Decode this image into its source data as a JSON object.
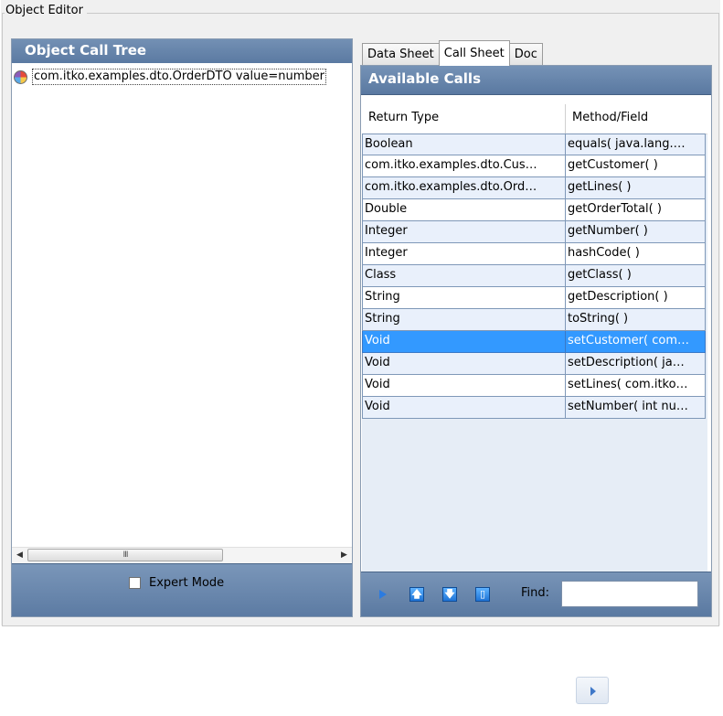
{
  "group": {
    "title": "Object Editor"
  },
  "left": {
    "header": "Object Call Tree",
    "tree_item": "com.itko.examples.dto.OrderDTO value=number",
    "scroll_grip": "III",
    "expert_mode_label": "Expert Mode",
    "expert_mode_checked": false
  },
  "tabs": [
    {
      "label": "Data Sheet",
      "active": false
    },
    {
      "label": "Call Sheet",
      "active": true
    },
    {
      "label": "Doc",
      "active": false
    }
  ],
  "calls": {
    "header": "Available Calls",
    "columns": [
      "Return Type",
      "Method/Field"
    ],
    "rows": [
      {
        "return_type": "Boolean",
        "method": "equals( java.lang.…"
      },
      {
        "return_type": "com.itko.examples.dto.Cus…",
        "method": "getCustomer( )"
      },
      {
        "return_type": "com.itko.examples.dto.Ord…",
        "method": "getLines( )"
      },
      {
        "return_type": "Double",
        "method": "getOrderTotal( )"
      },
      {
        "return_type": "Integer",
        "method": "getNumber( )"
      },
      {
        "return_type": "Integer",
        "method": "hashCode( )"
      },
      {
        "return_type": "Class",
        "method": "getClass( )"
      },
      {
        "return_type": "String",
        "method": "getDescription( )"
      },
      {
        "return_type": "String",
        "method": "toString( )"
      },
      {
        "return_type": "Void",
        "method": "setCustomer( com…",
        "selected": true
      },
      {
        "return_type": "Void",
        "method": "setDescription( ja…"
      },
      {
        "return_type": "Void",
        "method": "setLines( com.itko…"
      },
      {
        "return_type": "Void",
        "method": "setNumber( int nu…"
      }
    ],
    "find_label": "Find:",
    "find_value": ""
  },
  "colors": {
    "header_blue": "#5b7aa2",
    "selection": "#3399ff",
    "row_alt": "#e9f0fb"
  }
}
